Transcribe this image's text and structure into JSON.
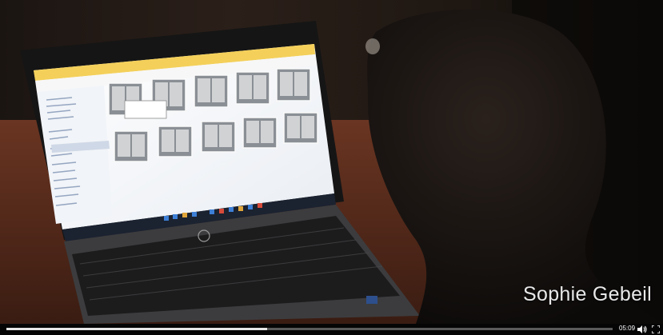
{
  "video": {
    "caption": "Sophie Gebeil",
    "time": "05:09",
    "progress": 0.43
  },
  "icons": {
    "volume": "volume-icon",
    "fullscreen": "fullscreen-icon",
    "laptop_logo": "hp-logo"
  }
}
